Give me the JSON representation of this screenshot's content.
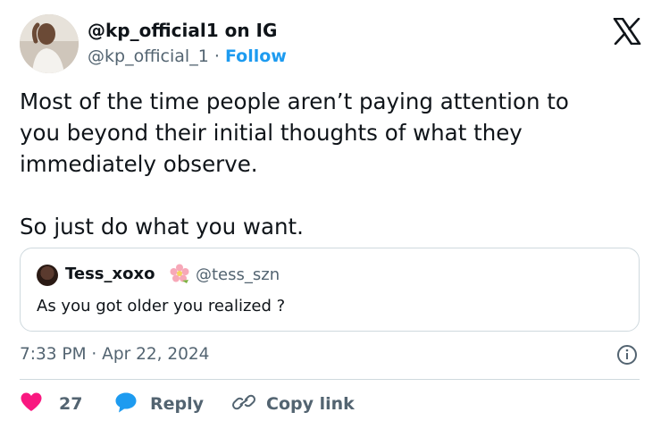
{
  "author": {
    "name": "@kp_official1 on IG",
    "handle": "@kp_official_1",
    "separator": "·",
    "follow_label": "Follow"
  },
  "tweet": {
    "text": "Most of the time people aren’t paying attention to\nyou beyond their initial thoughts of what they\nimmediately observe.\n\nSo just do what you want."
  },
  "quote": {
    "name": "Tess_xoxo",
    "handle": "@tess_szn",
    "text": "As you got older you realized ?"
  },
  "timestamp": "7:33 PM · Apr 22, 2024",
  "actions": {
    "like_count": "27",
    "reply_label": "Reply",
    "copy_label": "Copy link"
  },
  "colors": {
    "accent": "#1d9bf0",
    "like": "#f91880",
    "muted": "#536471"
  },
  "icons": [
    "x-logo-icon",
    "info-icon",
    "heart-icon",
    "reply-bubble-icon",
    "link-icon",
    "flower-emoji-icon"
  ]
}
